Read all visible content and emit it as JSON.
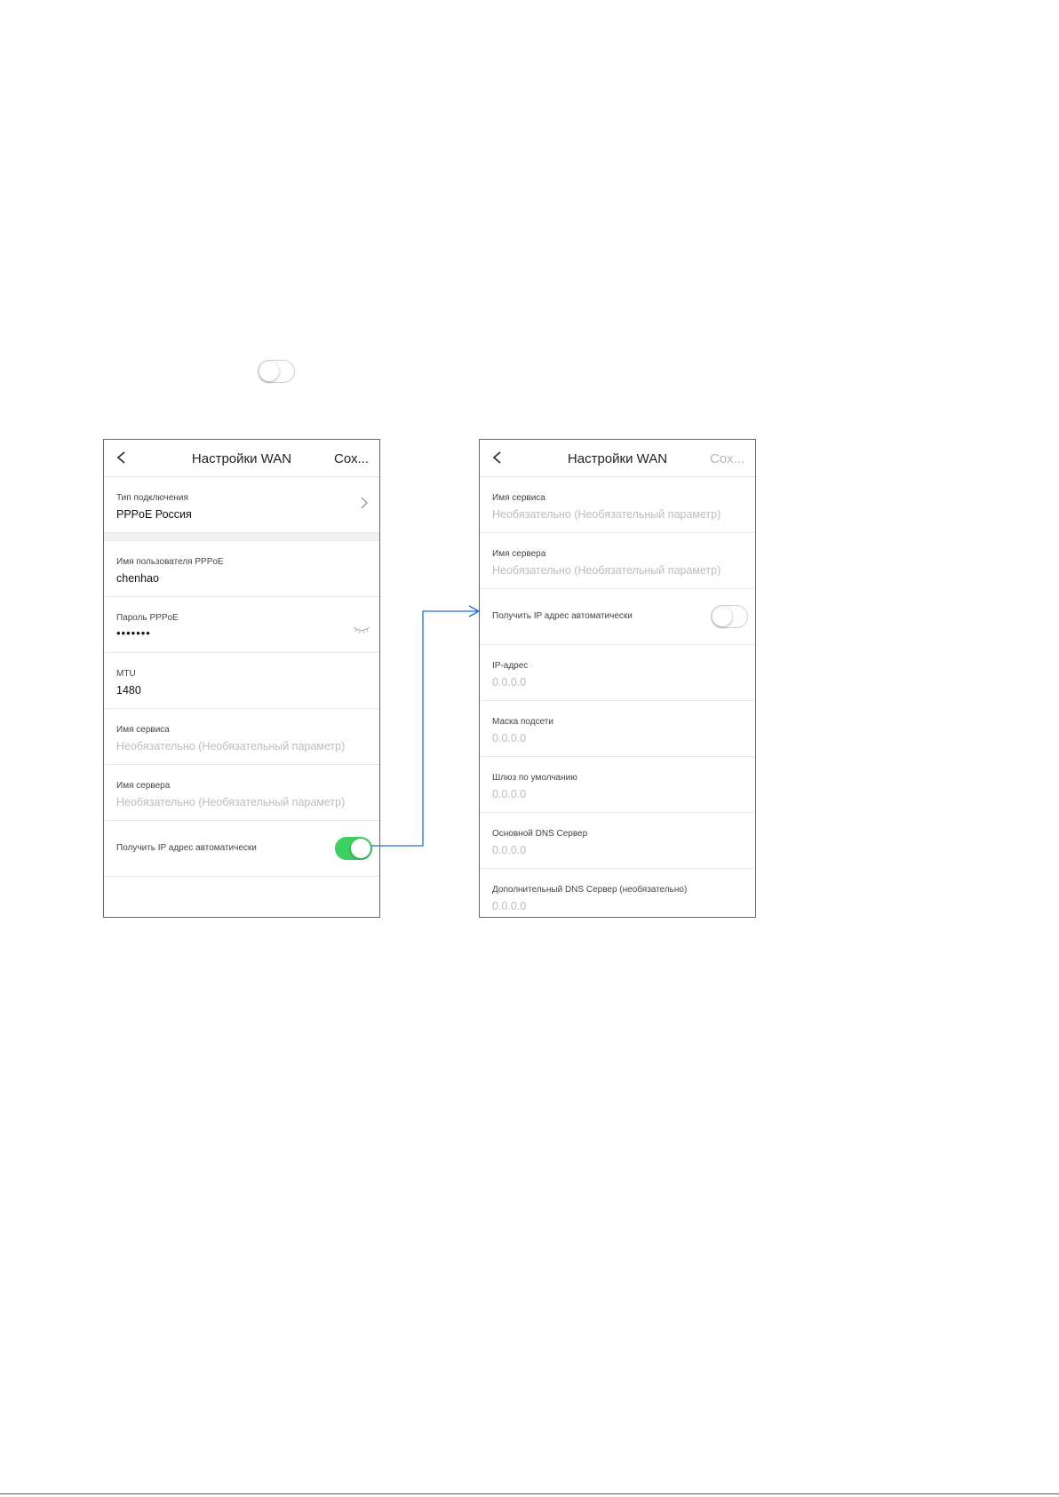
{
  "left_screen": {
    "title": "Настройки WAN",
    "save_label": "Сох...",
    "connection_type": {
      "label": "Тип подключения",
      "value": "PPPoE Россия"
    },
    "fields": [
      {
        "label": "Имя пользователя PPPoE",
        "value": "chenhao"
      },
      {
        "label": "Пароль PPPoE",
        "value": "•••••••"
      },
      {
        "label": "MTU",
        "value": "1480"
      },
      {
        "label": "Имя сервиса",
        "placeholder": "Необязательно (Необязательный параметр)"
      },
      {
        "label": "Имя сервера",
        "placeholder": "Необязательно (Необязательный параметр)"
      }
    ],
    "auto_ip": {
      "label": "Получить IP адрес автоматически",
      "state": "on"
    }
  },
  "right_screen": {
    "title": "Настройки WAN",
    "save_label": "Сох...",
    "fields_top": [
      {
        "label": "Имя сервиса",
        "placeholder": "Необязательно (Необязательный параметр)"
      },
      {
        "label": "Имя сервера",
        "placeholder": "Необязательно (Необязательный параметр)"
      }
    ],
    "auto_ip": {
      "label": "Получить IP адрес автоматически",
      "state": "off"
    },
    "fields_bottom": [
      {
        "label": "IP-адрес",
        "placeholder": "0.0.0.0"
      },
      {
        "label": "Маска подсети",
        "placeholder": "0.0.0.0"
      },
      {
        "label": "Шлюз по умолчанию",
        "placeholder": "0.0.0.0"
      },
      {
        "label": "Основной DNS Сервер",
        "placeholder": "0.0.0.0"
      },
      {
        "label": "Дополнительный DNS Сервер (необязательно)",
        "placeholder": "0.0.0.0"
      }
    ]
  },
  "colors": {
    "toggle_on": "#3ecf63",
    "arrow": "#1f6fd1"
  },
  "icons": [
    "chevron-left-icon",
    "chevron-right-icon",
    "eye-closed-icon"
  ]
}
